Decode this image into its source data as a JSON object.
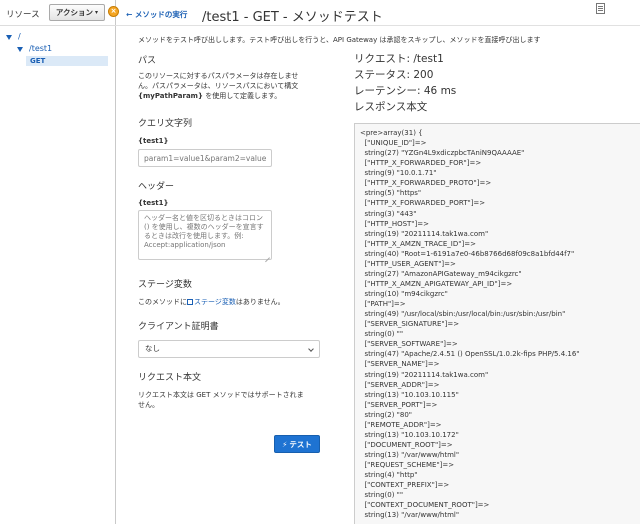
{
  "sidebar": {
    "title": "リソース",
    "actions_label": "アクション",
    "tree": [
      {
        "label": "/"
      },
      {
        "label": "/test1"
      },
      {
        "label": "GET"
      }
    ]
  },
  "header": {
    "back_label": "メソッドの実行",
    "title": "/test1 - GET - メソッドテスト"
  },
  "description": "メソッドをテスト呼び出しします。テスト呼び出しを行うと、API Gateway は承認をスキップし、メソッドを直接呼び出します",
  "path_section": {
    "title": "パス",
    "line1": "このリソースに対するパスパラメータは存在しませ",
    "line2": "ん。パスパラメータは、リソースパスにおいて構文",
    "line3_param": "{myPathParam}",
    "line3_rest": " を使用して定義します。"
  },
  "query_section": {
    "title": "クエリ文字列",
    "label": "{test1}",
    "placeholder": "param1=value1&param2=value2"
  },
  "headers_section": {
    "title": "ヘッダー",
    "label": "{test1}",
    "placeholder": "ヘッダー名と値を区切るときはコロン() を使用し、複数のヘッダーを宣言するときは改行を使用します。例: Accept:application/json"
  },
  "stage_section": {
    "title": "ステージ変数",
    "prefix": "このメソッドに",
    "link": "ステージ変数",
    "suffix": "はありません。"
  },
  "cert_section": {
    "title": "クライアント証明書",
    "selected": "なし"
  },
  "body_section": {
    "title": "リクエスト本文",
    "line1": "リクエスト本文は GET メソッドではサポートされま",
    "line2": "せん。"
  },
  "test_button": "テスト",
  "response": {
    "request": "リクエスト: /test1",
    "status": "ステータス: 200",
    "latency": "レーテンシー: 46 ms",
    "body_title": "レスポンス本文",
    "body": "<pre>array(31) {\n  [\"UNIQUE_ID\"]=>\n  string(27) \"YZGn4L9xdiczpbcTAniN9QAAAAE\"\n  [\"HTTP_X_FORWARDED_FOR\"]=>\n  string(9) \"10.0.1.71\"\n  [\"HTTP_X_FORWARDED_PROTO\"]=>\n  string(5) \"https\"\n  [\"HTTP_X_FORWARDED_PORT\"]=>\n  string(3) \"443\"\n  [\"HTTP_HOST\"]=>\n  string(19) \"20211114.tak1wa.com\"\n  [\"HTTP_X_AMZN_TRACE_ID\"]=>\n  string(40) \"Root=1-6191a7e0-46b8766d68f09c8a1bfd44f7\"\n  [\"HTTP_USER_AGENT\"]=>\n  string(27) \"AmazonAPIGateway_m94cikgzrc\"\n  [\"HTTP_X_AMZN_APIGATEWAY_API_ID\"]=>\n  string(10) \"m94cikgzrc\"\n  [\"PATH\"]=>\n  string(49) \"/usr/local/sbin:/usr/local/bin:/usr/sbin:/usr/bin\"\n  [\"SERVER_SIGNATURE\"]=>\n  string(0) \"\"\n  [\"SERVER_SOFTWARE\"]=>\n  string(47) \"Apache/2.4.51 () OpenSSL/1.0.2k-fips PHP/5.4.16\"\n  [\"SERVER_NAME\"]=>\n  string(19) \"20211114.tak1wa.com\"\n  [\"SERVER_ADDR\"]=>\n  string(13) \"10.103.10.115\"\n  [\"SERVER_PORT\"]=>\n  string(2) \"80\"\n  [\"REMOTE_ADDR\"]=>\n  string(13) \"10.103.10.172\"\n  [\"DOCUMENT_ROOT\"]=>\n  string(13) \"/var/www/html\"\n  [\"REQUEST_SCHEME\"]=>\n  string(4) \"http\"\n  [\"CONTEXT_PREFIX\"]=>\n  string(0) \"\"\n  [\"CONTEXT_DOCUMENT_ROOT\"]=>\n  string(13) \"/var/www/html\""
  },
  "colors": {
    "link": "#1a5fb4",
    "primary_button": "#1e73d2",
    "selected_row": "#dbe9f7",
    "handle": "#f5a623"
  }
}
